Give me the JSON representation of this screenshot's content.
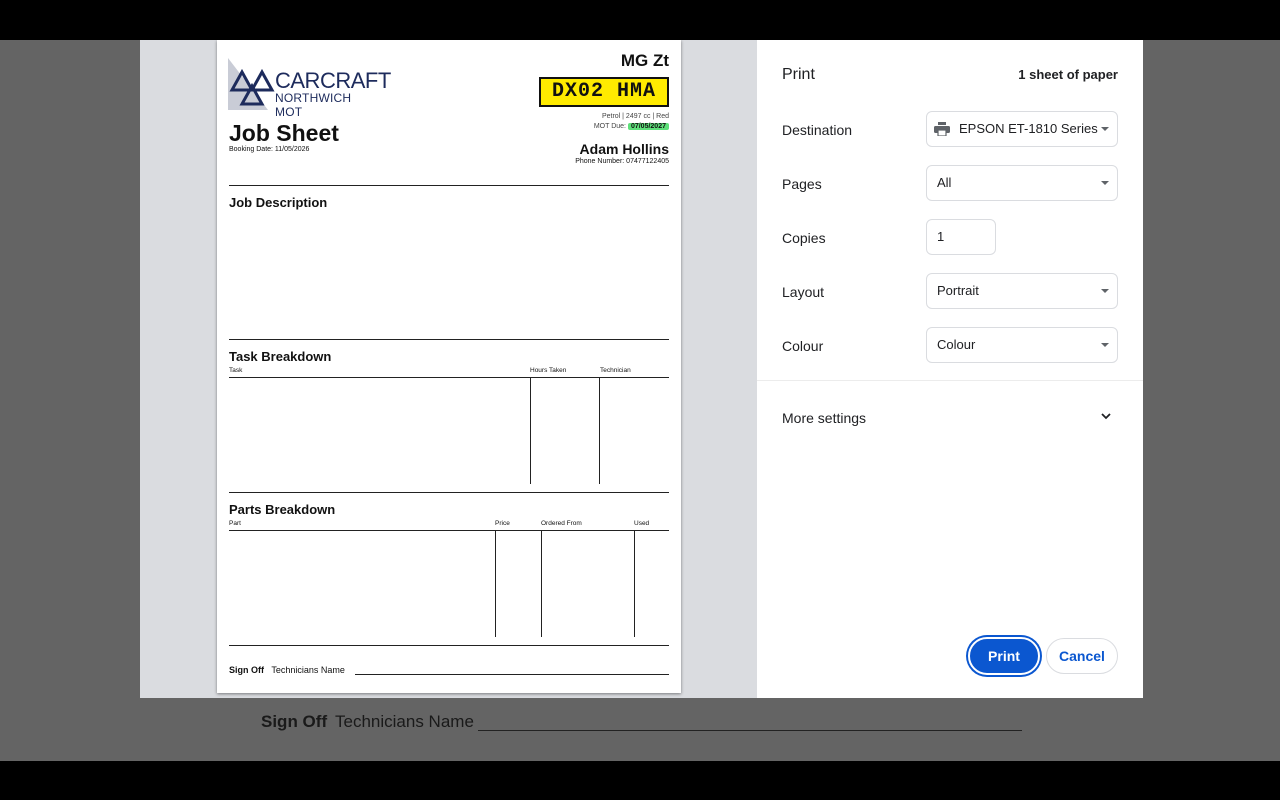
{
  "background": {
    "signoff_label": "Sign Off",
    "technicians_label": "Technicians Name"
  },
  "document": {
    "logo_line1": "CARCRAFT",
    "logo_line2": "NORTHWICH MOT",
    "title": "Job Sheet",
    "booking_date": "Booking Date: 11/05/2026",
    "car_model": "MG Zt",
    "plate": "DX02 HMA",
    "car_meta": "Petrol | 2497 cc | Red",
    "mot_label": "MOT Due:",
    "mot_date": "07/05/2027",
    "customer_name": "Adam Hollins",
    "phone": "Phone Number: 07477122405",
    "job_description_title": "Job Description",
    "task_breakdown": {
      "title": "Task Breakdown",
      "columns": [
        "Task",
        "Hours Taken",
        "Technician"
      ]
    },
    "parts_breakdown": {
      "title": "Parts Breakdown",
      "columns": [
        "Part",
        "Price",
        "Ordered From",
        "Used"
      ]
    },
    "signoff_label": "Sign Off",
    "technicians_label": "Technicians Name"
  },
  "print_panel": {
    "title": "Print",
    "sheets": "1 sheet of paper",
    "destination_label": "Destination",
    "destination_value": "EPSON ET-1810 Series",
    "pages_label": "Pages",
    "pages_value": "All",
    "copies_label": "Copies",
    "copies_value": "1",
    "layout_label": "Layout",
    "layout_value": "Portrait",
    "colour_label": "Colour",
    "colour_value": "Colour",
    "more_settings": "More settings",
    "print_button": "Print",
    "cancel_button": "Cancel"
  },
  "colors": {
    "accent": "#0b57d0",
    "plate_yellow": "#ffeb00",
    "mot_green": "#5ee07a"
  },
  "icons": [
    "printer-icon",
    "chevron-down-icon",
    "mot-triangle-logo"
  ]
}
